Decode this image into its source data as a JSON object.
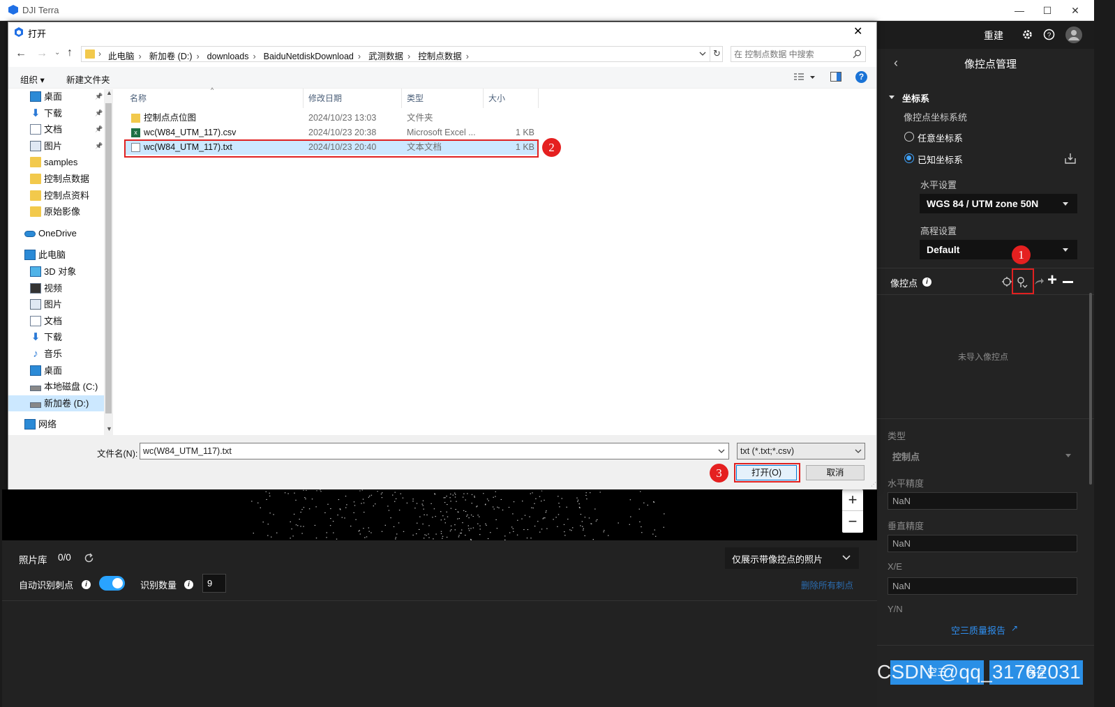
{
  "app": {
    "title": "DJI Terra",
    "window_controls": {
      "minimize": "—",
      "maximize": "☐",
      "close": "✕"
    }
  },
  "topbar": {
    "rebuild_label": "重建"
  },
  "gcp_panel": {
    "title": "像控点管理",
    "coord_section": "坐标系",
    "coord_system_label": "像控点坐标系统",
    "radio_arbitrary": "任意坐标系",
    "radio_known": "已知坐标系",
    "horizontal_label": "水平设置",
    "horizontal_value": "WGS 84 / UTM zone 50N",
    "elevation_label": "高程设置",
    "elevation_value": "Default",
    "gcp_label": "像控点",
    "empty_text": "未导入像控点",
    "type_label": "类型",
    "type_value": "控制点",
    "h_accuracy_label": "水平精度",
    "h_accuracy_value": "NaN",
    "v_accuracy_label": "垂直精度",
    "v_accuracy_value": "NaN",
    "xe_label": "X/E",
    "xe_value": "NaN",
    "yn_label": "Y/N",
    "report_link": "空三质量报告",
    "watermark": "CSDN @qq_31762031",
    "bottom_btn_1": "空三",
    "bottom_btn_2": "保存"
  },
  "annotations": {
    "step1": "1",
    "step2": "2",
    "step3": "3",
    "accent": "#e02020"
  },
  "dialog": {
    "title": "打开",
    "close_glyph": "✕",
    "breadcrumb": [
      "此电脑",
      "新加卷 (D:)",
      "downloads",
      "BaiduNetdiskDownload",
      "武测数据",
      "控制点数据"
    ],
    "search_placeholder": "在 控制点数据 中搜索",
    "toolbar": {
      "organize": "组织 ▾",
      "new_folder": "新建文件夹",
      "help": "?"
    },
    "nav": {
      "quick": [
        "桌面",
        "下载",
        "文档",
        "图片",
        "samples",
        "控制点数据",
        "控制点资料",
        "原始影像"
      ],
      "onedrive": "OneDrive",
      "this_pc": "此电脑",
      "pc_items": [
        "3D 对象",
        "视频",
        "图片",
        "文档",
        "下载",
        "音乐",
        "桌面",
        "本地磁盘 (C:)",
        "新加卷 (D:)"
      ],
      "network": "网络"
    },
    "columns": {
      "name": "名称",
      "modified": "修改日期",
      "type": "类型",
      "size": "大小"
    },
    "files": [
      {
        "name": "控制点点位图",
        "modified": "2024/10/23 13:03",
        "type": "文件夹",
        "size": ""
      },
      {
        "name": "wc(W84_UTM_117).csv",
        "modified": "2024/10/23 20:38",
        "type": "Microsoft Excel ...",
        "size": "1 KB"
      },
      {
        "name": "wc(W84_UTM_117).txt",
        "modified": "2024/10/23 20:40",
        "type": "文本文档",
        "size": "1 KB"
      }
    ],
    "filename_label": "文件名(N):",
    "filename_value": "wc(W84_UTM_117).txt",
    "filter_value": "txt (*.txt;*.csv)",
    "open_button": "打开(O)",
    "cancel_button": "取消"
  },
  "map": {
    "zoom_in": "+",
    "zoom_out": "−"
  },
  "photo_panel": {
    "library_label": "照片库",
    "count": "0/0",
    "filter_value": "仅展示带像控点的照片",
    "auto_detect_label": "自动识别刺点",
    "auto_detect_on": true,
    "detect_count_label": "识别数量",
    "detect_count_value": "9",
    "delete_all": "删除所有刺点"
  }
}
